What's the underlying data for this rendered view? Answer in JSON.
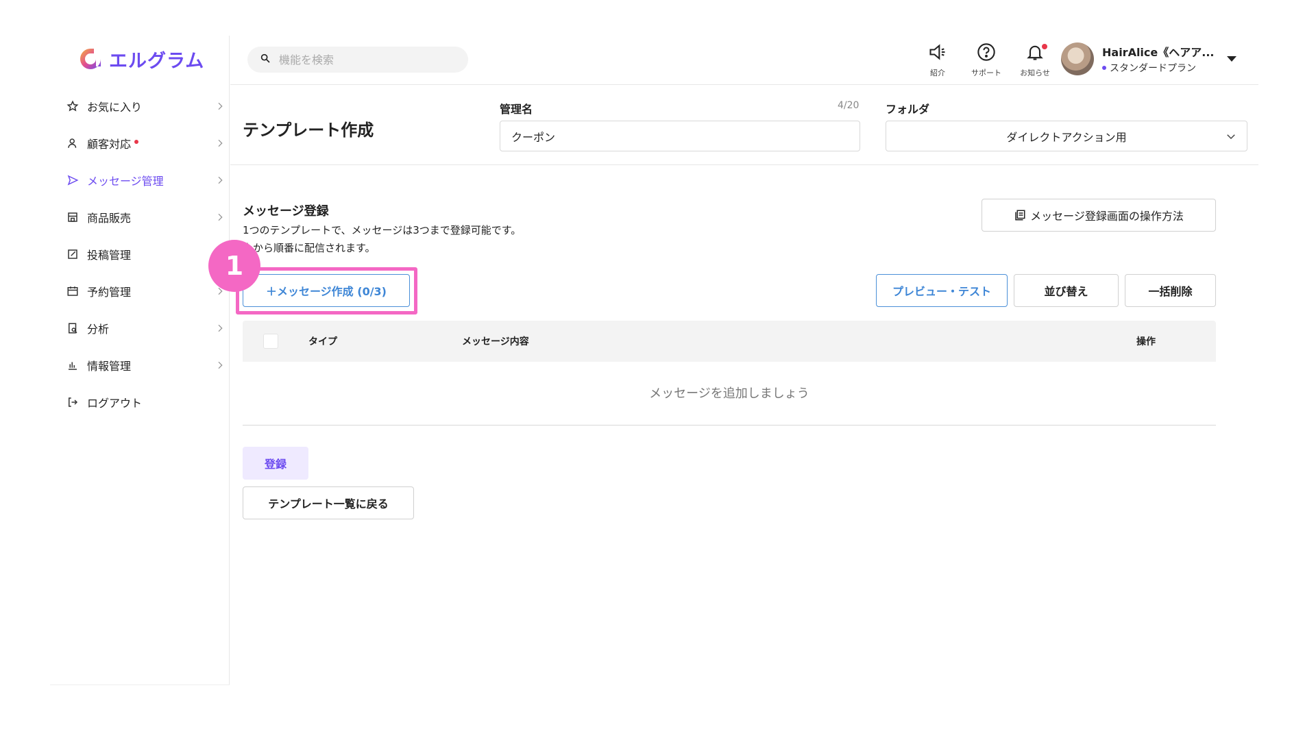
{
  "app": {
    "logo_text": "エルグラム",
    "brand_color": "#6c4bf0",
    "accent_color": "#3e86d6",
    "highlight_color": "#f468c4"
  },
  "sidebar": {
    "items": [
      {
        "label": "お気に入り",
        "icon": "star-icon",
        "active": false,
        "badge": false
      },
      {
        "label": "顧客対応",
        "icon": "user-icon",
        "active": false,
        "badge": true
      },
      {
        "label": "メッセージ管理",
        "icon": "send-icon",
        "active": true,
        "badge": false
      },
      {
        "label": "商品販売",
        "icon": "store-icon",
        "active": false,
        "badge": false
      },
      {
        "label": "投稿管理",
        "icon": "edit-icon",
        "active": false,
        "badge": false
      },
      {
        "label": "予約管理",
        "icon": "calendar-icon",
        "active": false,
        "badge": false
      },
      {
        "label": "分析",
        "icon": "report-icon",
        "active": false,
        "badge": false
      },
      {
        "label": "情報管理",
        "icon": "chart-icon",
        "active": false,
        "badge": false
      },
      {
        "label": "ログアウト",
        "icon": "logout-icon",
        "active": false,
        "badge": false
      }
    ]
  },
  "header": {
    "search_placeholder": "機能を検索",
    "buttons": {
      "intro": "紹介",
      "support": "サポート",
      "notifications": "お知らせ"
    },
    "user": {
      "name": "HairAlice《ヘアア...",
      "plan": "スタンダードプラン"
    }
  },
  "form": {
    "page_title": "テンプレート作成",
    "name_label": "管理名",
    "name_counter": "4/20",
    "name_value": "クーポン",
    "folder_label": "フォルダ",
    "folder_value": "ダイレクトアクション用"
  },
  "messages": {
    "section_title": "メッセージ登録",
    "desc_line1": "1つのテンプレートで、メッセージは3つまで登録可能です。",
    "desc_line2": "上から順番に配信されます。",
    "howto_label": "メッセージ登録画面の操作方法",
    "create_label": "＋メッセージ作成 (0/3)",
    "step_number": "1",
    "preview_label": "プレビュー・テスト",
    "sort_label": "並び替え",
    "bulk_delete_label": "一括削除",
    "table": {
      "col_type": "タイプ",
      "col_content": "メッセージ内容",
      "col_actions": "操作"
    },
    "empty_message": "メッセージを追加しましょう"
  },
  "footer_actions": {
    "register_label": "登録",
    "back_label": "テンプレート一覧に戻る"
  }
}
